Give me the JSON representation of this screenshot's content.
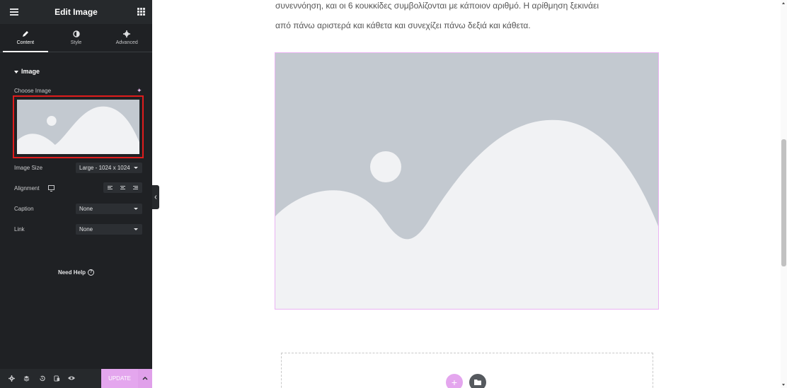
{
  "panel": {
    "title": "Edit Image",
    "menu_icon": "hamburger-icon",
    "apps_icon": "grid-icon"
  },
  "tabs": [
    {
      "label": "Content",
      "icon": "pencil-icon",
      "active": true
    },
    {
      "label": "Style",
      "icon": "contrast-icon",
      "active": false
    },
    {
      "label": "Advanced",
      "icon": "gear-icon",
      "active": false
    }
  ],
  "section": {
    "title": "Image"
  },
  "controls": {
    "choose_image_label": "Choose Image",
    "image_size_label": "Image Size",
    "image_size_value": "Large - 1024 x 1024",
    "alignment_label": "Alignment",
    "caption_label": "Caption",
    "caption_value": "None",
    "link_label": "Link",
    "link_value": "None"
  },
  "help": {
    "label": "Need Help",
    "icon": "question-circle-icon"
  },
  "footer": {
    "icons": [
      "settings-icon",
      "layers-icon",
      "history-icon",
      "responsive-icon",
      "preview-eye-icon"
    ],
    "update_label": "UPDATE"
  },
  "canvas": {
    "paragraph_line1": "συνεννόηση, και οι 6 κουκκίδες συμβολίζονται με κάποιον αριθμό. Η αρίθμηση ξεκινάει",
    "paragraph_line2": "από πάνω αριστερά και κάθετα και συνεχίζει πάνω δεξιά και κάθετα."
  },
  "colors": {
    "panel_bg": "#1f2124",
    "accent": "#e4a6ee",
    "highlight_border": "#e01c1c",
    "placeholder_bg": "#c3c9d0"
  }
}
